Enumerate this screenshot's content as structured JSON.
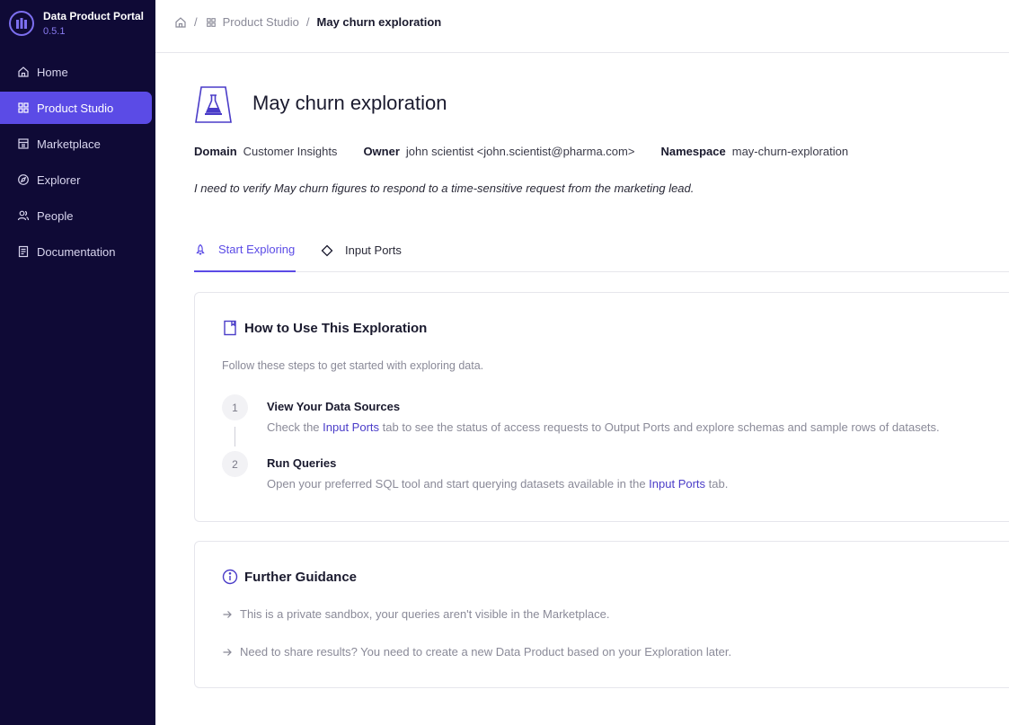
{
  "app": {
    "title": "Data Product Portal",
    "version": "0.5.1"
  },
  "sidebar": {
    "items": [
      {
        "label": "Home",
        "icon": "home-icon"
      },
      {
        "label": "Product Studio",
        "icon": "grid-icon",
        "active": true
      },
      {
        "label": "Marketplace",
        "icon": "store-icon"
      },
      {
        "label": "Explorer",
        "icon": "compass-icon"
      },
      {
        "label": "People",
        "icon": "people-icon"
      },
      {
        "label": "Documentation",
        "icon": "document-icon"
      }
    ]
  },
  "breadcrumb": {
    "parent": "Product Studio",
    "current": "May churn exploration",
    "separator": "/"
  },
  "page": {
    "title": "May churn exploration",
    "domain_label": "Domain",
    "domain_value": "Customer Insights",
    "owner_label": "Owner",
    "owner_value": "john scientist <john.scientist@pharma.com>",
    "namespace_label": "Namespace",
    "namespace_value": "may-churn-exploration",
    "description": "I need to verify May churn figures to respond to a time-sensitive request from the marketing lead."
  },
  "tabs": [
    {
      "label": "Start Exploring",
      "icon": "rocket-icon",
      "active": true
    },
    {
      "label": "Input Ports",
      "icon": "diamond-icon"
    }
  ],
  "how_to": {
    "title": "How to Use This Exploration",
    "subtitle": "Follow these steps to get started with exploring data.",
    "steps": [
      {
        "number": "1",
        "title": "View Your Data Sources",
        "desc_before": "Check the ",
        "desc_link": "Input Ports",
        "desc_after": " tab to see the status of access requests to Output Ports and explore schemas and sample rows of datasets."
      },
      {
        "number": "2",
        "title": "Run Queries",
        "desc_before": "Open your preferred SQL tool and start querying datasets available in the ",
        "desc_link": "Input Ports",
        "desc_after": " tab."
      }
    ]
  },
  "guidance": {
    "title": "Further Guidance",
    "items": [
      "This is a private sandbox, your queries aren't visible in the Marketplace.",
      "Need to share results? You need to create a new Data Product based on your Exploration later."
    ]
  },
  "colors": {
    "sidebar_bg": "#0f0a36",
    "accent": "#5b4be6",
    "link": "#4a3cc8"
  }
}
